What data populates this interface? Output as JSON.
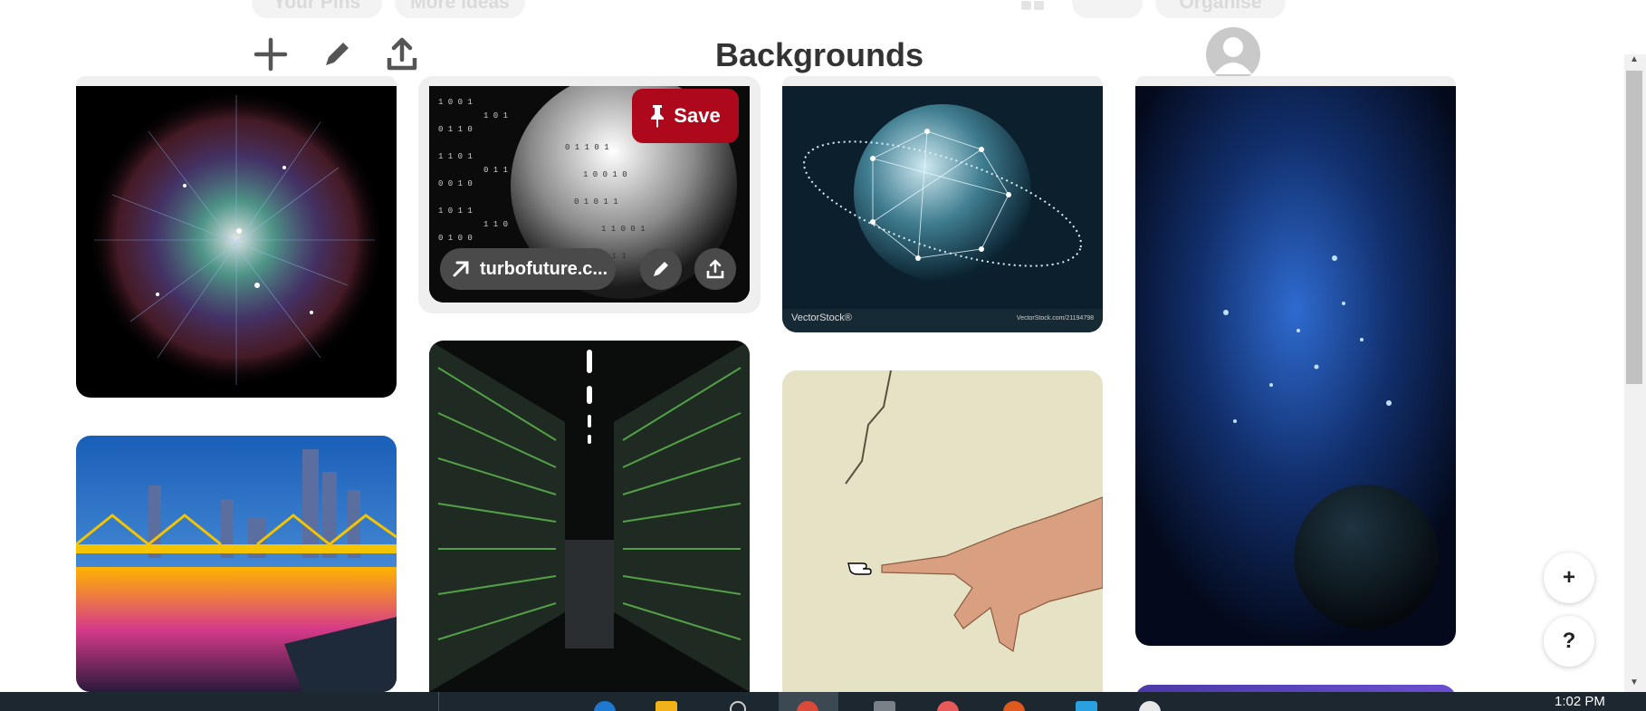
{
  "ghost_tabs": [
    "Your Pins",
    "More ideas",
    "Organise"
  ],
  "board": {
    "title": "Backgrounds"
  },
  "toolbar": {
    "add_icon": "plus-icon",
    "edit_icon": "pencil-icon",
    "share_icon": "share-icon"
  },
  "pins": {
    "hovered": {
      "save_label": "Save",
      "link_label": "turbofuture.c...",
      "link_icon": "arrow-up-right-icon"
    },
    "globe": {
      "watermark_left": "VectorStock®",
      "watermark_right": "VectorStock.com/21194798"
    }
  },
  "floating": {
    "add_label": "+",
    "help_label": "?"
  },
  "taskbar": {
    "time": "1:02 PM"
  },
  "colors": {
    "save": "#ad081b",
    "title": "#333333",
    "taskbar": "#1c2730"
  }
}
